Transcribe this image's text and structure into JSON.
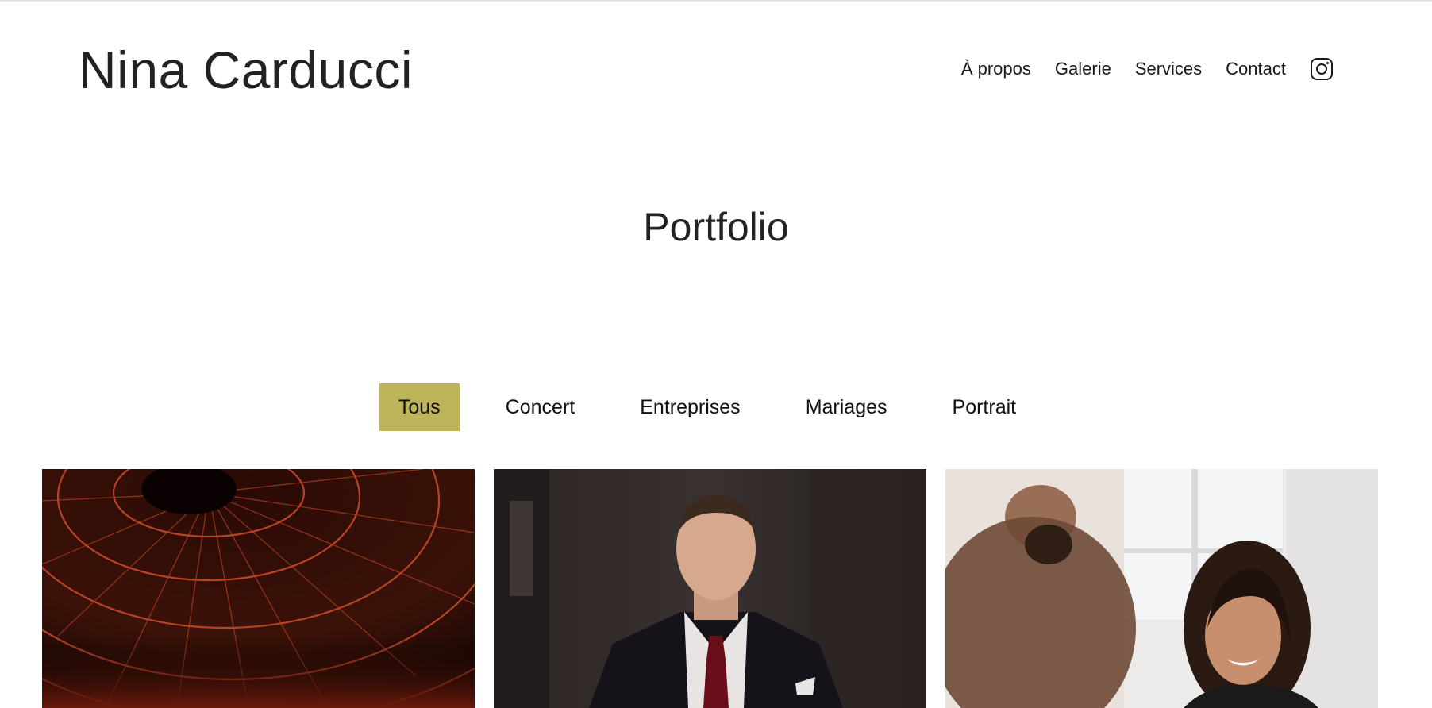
{
  "brand": {
    "name": "Nina Carducci"
  },
  "nav": {
    "items": [
      {
        "label": "À propos"
      },
      {
        "label": "Galerie"
      },
      {
        "label": "Services"
      },
      {
        "label": "Contact"
      }
    ],
    "social_icon": "instagram-icon"
  },
  "page": {
    "title": "Portfolio"
  },
  "filters": {
    "items": [
      {
        "label": "Tous",
        "active": true
      },
      {
        "label": "Concert",
        "active": false
      },
      {
        "label": "Entreprises",
        "active": false
      },
      {
        "label": "Mariages",
        "active": false
      },
      {
        "label": "Portrait",
        "active": false
      }
    ],
    "active_color": "#beb45a"
  },
  "gallery": {
    "photos": [
      {
        "subject": "concert-stage-lighting-rig"
      },
      {
        "subject": "man-in-suit-portrait"
      },
      {
        "subject": "smiling-woman-business-meeting"
      }
    ]
  }
}
